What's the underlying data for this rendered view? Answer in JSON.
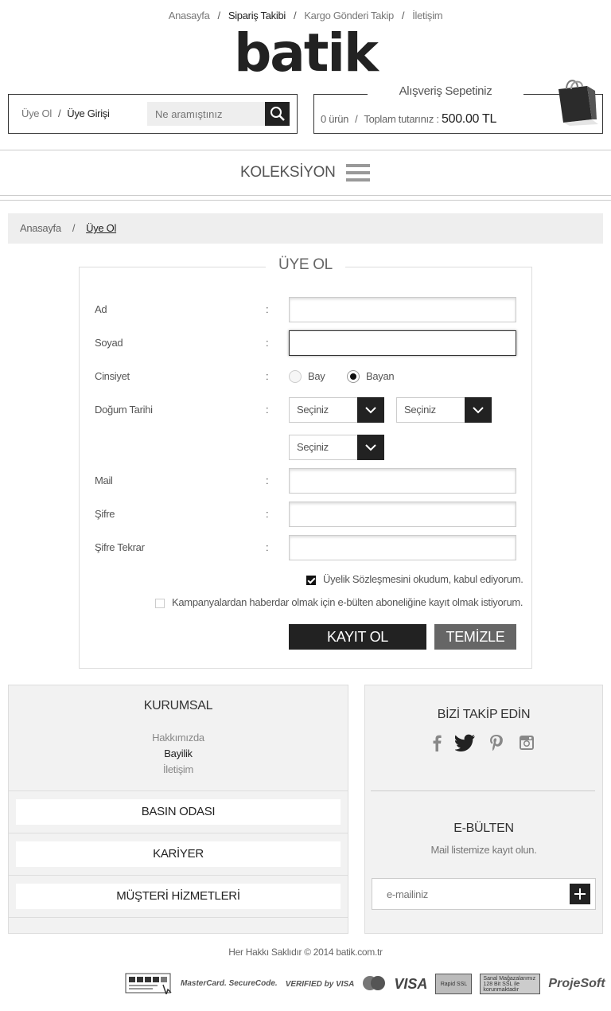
{
  "topnav": {
    "items": [
      "Anasayfa",
      "Sipariş Takibi",
      "Kargo Gönderi Takip",
      "İletişim"
    ],
    "separator": "/"
  },
  "logo": {
    "text": "batik"
  },
  "account": {
    "register": "Üye Ol",
    "login": "Üye Girişi",
    "separator": "/",
    "search_placeholder": "Ne aramıştınız"
  },
  "cart": {
    "title": "Alışveriş Sepetiniz",
    "count_label": "0 ürün",
    "separator": "/",
    "total_label": "Toplam tutarınız : ",
    "total_value": "500.00 TL"
  },
  "mainnav": {
    "collection": "KOLEKSİYON"
  },
  "breadcrumb": {
    "home": "Anasayfa",
    "separator": "/",
    "current": "Üye Ol"
  },
  "form": {
    "title": "ÜYE OL",
    "colon": ":",
    "labels": {
      "first_name": "Ad",
      "last_name": "Soyad",
      "gender": "Cinsiyet",
      "birth_date": "Doğum Tarihi",
      "mail": "Mail",
      "password": "Şifre",
      "password_repeat": "Şifre Tekrar"
    },
    "gender_options": {
      "male": "Bay",
      "female": "Bayan",
      "selected": "Bayan"
    },
    "birth_selects": {
      "day": "Seçiniz",
      "month": "Seçiniz",
      "year": "Seçiniz"
    },
    "agreement_label": "Üyelik Sözleşmesini okudum, kabul ediyorum.",
    "agreement_checked": true,
    "newsletter_label": "Kampanyalardan haberdar olmak için e-bülten aboneliğine kayıt olmak istiyorum.",
    "newsletter_checked": false,
    "submit": "KAYIT OL",
    "clear": "TEMİZLE"
  },
  "footer": {
    "corporate": {
      "title": "KURUMSAL",
      "links": [
        "Hakkımızda",
        "Bayilik",
        "İletişim"
      ]
    },
    "sections": [
      "BASIN ODASI",
      "KARİYER",
      "MÜŞTERİ HİZMETLERİ"
    ],
    "follow": {
      "title": "BİZİ TAKİP EDİN",
      "icons": [
        "facebook-icon",
        "twitter-icon",
        "pinterest-icon",
        "instagram-icon"
      ]
    },
    "newsletter": {
      "title": "E-BÜLTEN",
      "subtitle": "Mail listemize kayıt olun.",
      "placeholder": "e-mailiniz"
    },
    "copyright": "Her Hakkı Saklıdır © 2014  batik.com.tr",
    "badges": {
      "mastercard_securecode": "MasterCard. SecureCode.",
      "verified_by_visa": "VERIFIED by VISA",
      "mastercard": "MasterCard",
      "visa": "VISA",
      "rapid_ssl": "Rapid SSL",
      "ssl_text": "Sanal Mağazalarımız 128 Bit SSL ile korunmaktadır",
      "projesoft": "ProjeSoft"
    }
  }
}
